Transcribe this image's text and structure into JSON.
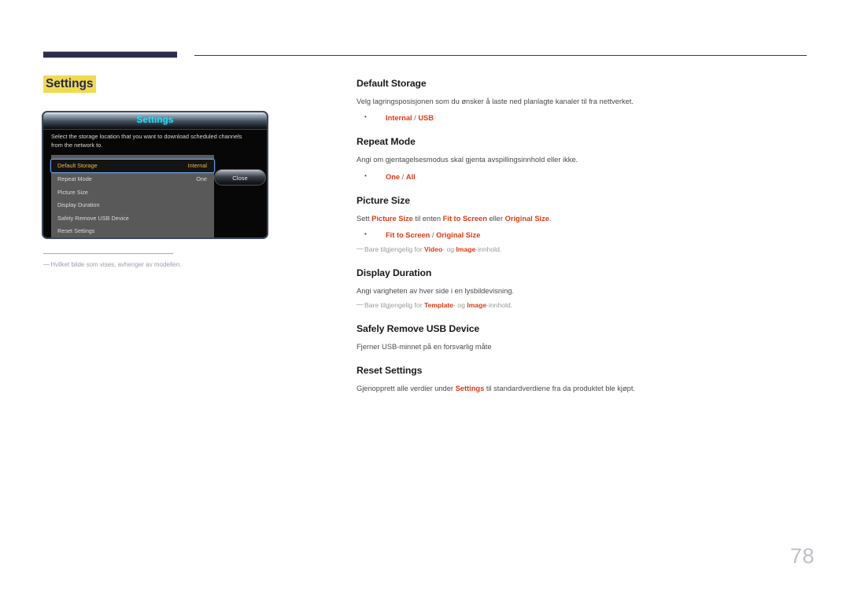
{
  "page": {
    "number": "78",
    "section_chip": "Settings"
  },
  "osd": {
    "title": "Settings",
    "description": "Select the storage location that you want to download scheduled channels from the network to.",
    "rows": [
      {
        "label": "Default Storage",
        "value": "Internal",
        "selected": true
      },
      {
        "label": "Repeat Mode",
        "value": "One",
        "selected": false
      },
      {
        "label": "Picture Size",
        "value": "",
        "selected": false
      },
      {
        "label": "Display Duration",
        "value": "",
        "selected": false
      },
      {
        "label": "Safely Remove USB Device",
        "value": "",
        "selected": false
      },
      {
        "label": "Reset Settings",
        "value": "",
        "selected": false
      }
    ],
    "close_label": "Close",
    "footnote": "Hvilket bilde som vises, avhenger av modellen.",
    "footnote_dash": "—"
  },
  "content": {
    "default_storage": {
      "title": "Default Storage",
      "desc": "Velg lagringsposisjonen som du ønsker å laste ned planlagte kanaler til fra nettverket.",
      "opt_a": "Internal",
      "opt_sep": " / ",
      "opt_b": "USB"
    },
    "repeat_mode": {
      "title": "Repeat Mode",
      "desc": "Angi om gjentagelsesmodus skal gjenta avspillingsinnhold eller ikke.",
      "opt_a": "One",
      "opt_sep": " / ",
      "opt_b": "All"
    },
    "picture_size": {
      "title": "Picture Size",
      "desc_1": "Sett ",
      "desc_term_1": "Picture Size",
      "desc_2": " til enten ",
      "desc_term_2": "Fit to Screen",
      "desc_3": " eller ",
      "desc_term_3": "Original Size",
      "desc_4": ".",
      "opt_a": "Fit to Screen",
      "opt_sep": " / ",
      "opt_b": "Original Size",
      "note_1": "Bare tilgjengelig for ",
      "note_term_1": "Video",
      "note_2": "- og ",
      "note_term_2": "Image",
      "note_3": "-innhold."
    },
    "display_duration": {
      "title": "Display Duration",
      "desc": "Angi varigheten av hver side i en lysbildevisning.",
      "note_1": "Bare tilgjengelig for ",
      "note_term_1": "Template",
      "note_2": "- og ",
      "note_term_2": "Image",
      "note_3": "-innhold."
    },
    "safely_remove": {
      "title": "Safely Remove USB Device",
      "desc": "Fjerner USB-minnet på en forsvarlig måte"
    },
    "reset_settings": {
      "title": "Reset Settings",
      "desc_1": "Gjenopprett alle verdier under ",
      "desc_term_1": "Settings",
      "desc_2": " til standardverdiene fra da produktet ble kjøpt."
    }
  },
  "note_dash": "—"
}
